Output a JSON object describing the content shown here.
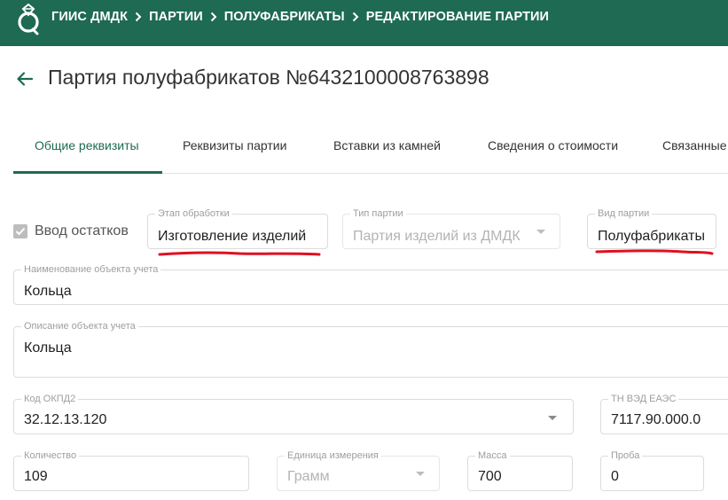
{
  "header": {
    "logo_icon": "ring-gem-logo-icon",
    "breadcrumbs": [
      "ГИИС ДМДК",
      "ПАРТИИ",
      "ПОЛУФАБРИКАТЫ",
      "РЕДАКТИРОВАНИЕ ПАРТИИ"
    ],
    "bg_color": "#1e6a52"
  },
  "page": {
    "back_icon": "arrow-left-icon",
    "title": "Партия полуфабрикатов №6432100008763898"
  },
  "tabs": [
    {
      "label": "Общие реквизиты",
      "active": true
    },
    {
      "label": "Реквизиты партии",
      "active": false
    },
    {
      "label": "Вставки из камней",
      "active": false
    },
    {
      "label": "Сведения о стоимости",
      "active": false
    },
    {
      "label": "Связанные",
      "active": false
    }
  ],
  "form": {
    "residual_input": {
      "label": "Ввод остатков",
      "checked": true
    },
    "stage": {
      "label": "Этап обработки",
      "value": "Изготовление изделий"
    },
    "batch_type": {
      "label": "Тип партии",
      "value": "Партия изделий из ДМДК"
    },
    "batch_kind": {
      "label": "Вид партии",
      "value": "Полуфабрикаты"
    },
    "object_name": {
      "label": "Наименование объекта учета",
      "value": "Кольца"
    },
    "object_description": {
      "label": "Описание объекта учета",
      "value": "Кольца"
    },
    "okpd2": {
      "label": "Код ОКПД2",
      "value": "32.12.13.120"
    },
    "tn_ved": {
      "label": "ТН ВЭД ЕАЭС",
      "value": "7117.90.000.0"
    },
    "quantity": {
      "label": "Количество",
      "value": "109"
    },
    "unit": {
      "label": "Единица измерения",
      "value": "Грамм"
    },
    "mass": {
      "label": "Масса",
      "value": "700"
    },
    "probe": {
      "label": "Проба",
      "value": "0"
    }
  },
  "colors": {
    "accent": "#1e6a52",
    "annotation": "#e01020"
  }
}
